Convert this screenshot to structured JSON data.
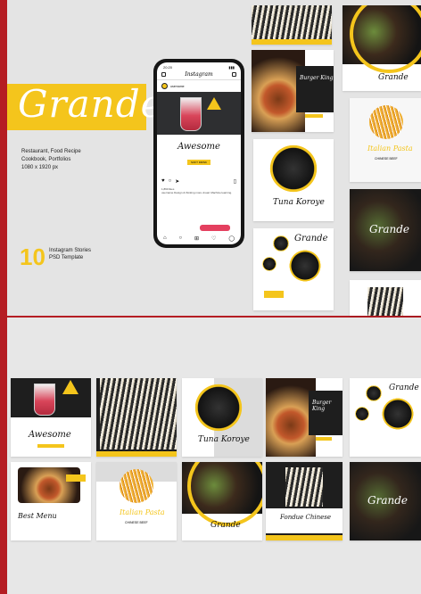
{
  "brand": {
    "title": "Grande",
    "accent": "#f4c51c",
    "frame": "#b51d23"
  },
  "description": {
    "line1": "Restaurant, Food Recipe",
    "line2": "Cookbook, Portfolios",
    "line3": "1080 x 1920 px"
  },
  "stories": {
    "count": "10",
    "line1": "Instagram Stories",
    "line2": "PSD Template"
  },
  "phone": {
    "time": "20:20",
    "app": "Instagram",
    "user": "username",
    "post_title": "Awesome",
    "post_sub": "SOFT DRINK",
    "likes": "1,890 likes",
    "caption": "username Design & thinking more visual. Machine learning."
  },
  "cards": {
    "burger_title": "Burger King",
    "grande": "Grande",
    "tuna": "Tuna Koroye",
    "italian_pasta": "Italian Pasta",
    "pasta_sub": "CHINESE BEEF",
    "awesome": "Awesome",
    "best_menu": "Best Menu",
    "fondue": "Fondue Chinese"
  },
  "icons": [
    "heart-icon",
    "comment-icon",
    "share-icon",
    "bookmark-icon",
    "home-icon",
    "search-icon",
    "add-icon",
    "like-icon",
    "profile-icon"
  ]
}
